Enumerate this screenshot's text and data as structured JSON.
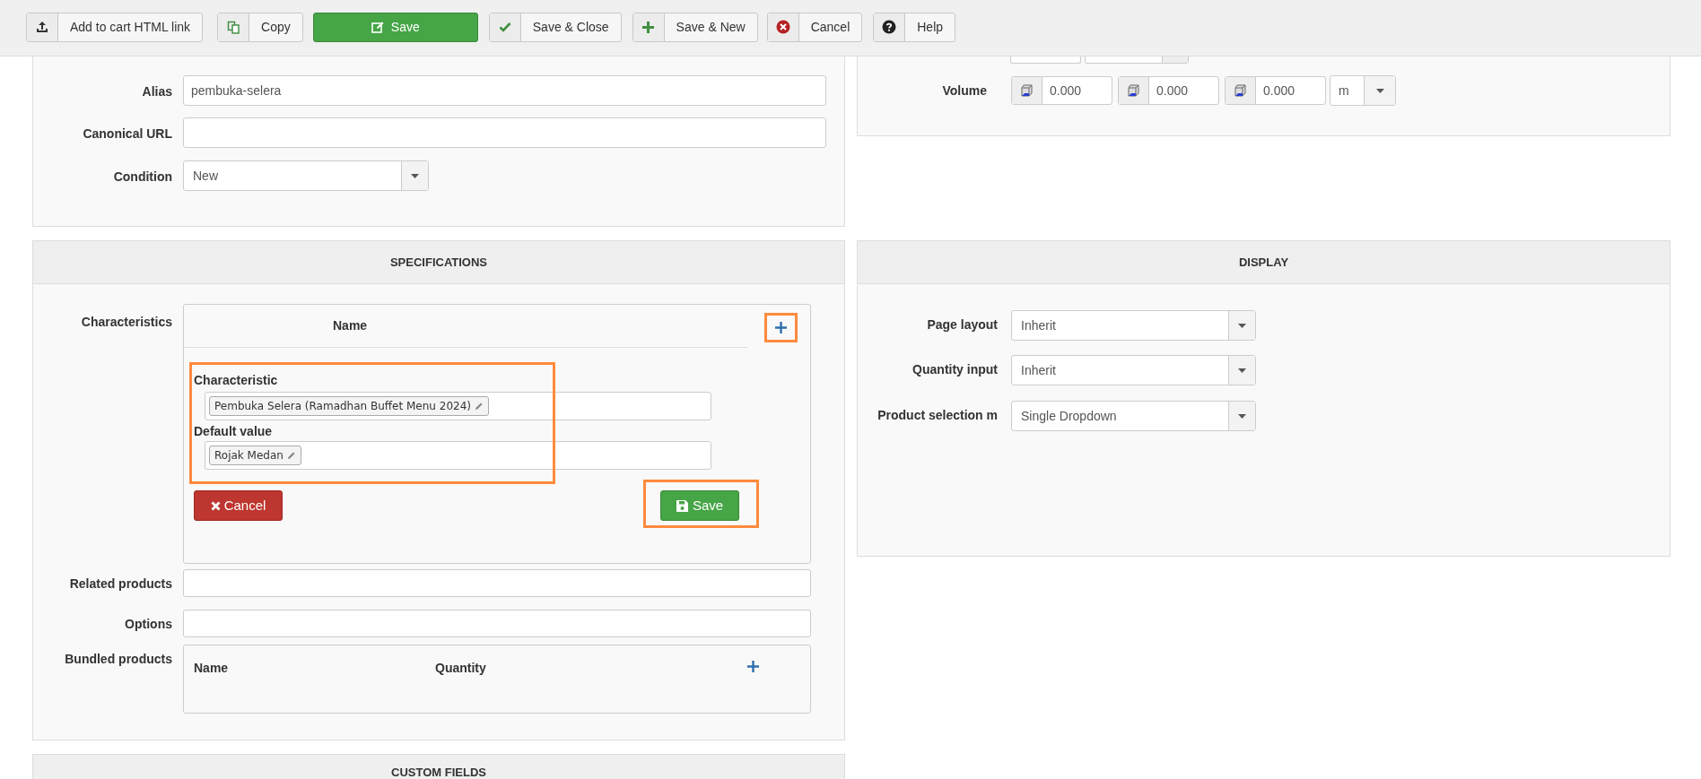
{
  "toolbar": {
    "buttons": [
      {
        "kind": "link",
        "label": "Add to cart HTML link"
      },
      {
        "kind": "copy",
        "label": "Copy"
      },
      {
        "kind": "save",
        "label": "Save"
      },
      {
        "kind": "save_close",
        "label": "Save & Close"
      },
      {
        "kind": "save_new",
        "label": "Save & New"
      },
      {
        "kind": "cancel",
        "label": "Cancel"
      },
      {
        "kind": "help",
        "label": "Help"
      }
    ]
  },
  "general": {
    "fields": [
      {
        "kind": "text",
        "label": "Alias",
        "value": "pembuka-selera"
      },
      {
        "kind": "text",
        "label": "Canonical URL"
      },
      {
        "kind": "select",
        "label": "Condition",
        "value": "New"
      }
    ]
  },
  "dimensions": {
    "volume": {
      "label": "Volume",
      "values": [
        "0.000",
        "0.000",
        "0.000"
      ],
      "unit": "m"
    }
  },
  "specifications": {
    "title": "SPECIFICATIONS",
    "characteristics": {
      "label": "Characteristics",
      "column": "Name",
      "add_highlighted": true,
      "editor": {
        "highlighted": true,
        "characteristic_label": "Characteristic",
        "characteristic_tag": "Pembuka Selera (Ramadhan Buffet Menu 2024)",
        "default_label": "Default value",
        "default_tag": "Rojak Medan",
        "cancel": "Cancel",
        "save": "Save",
        "save_highlighted": true
      }
    },
    "related_products": {
      "label": "Related products"
    },
    "options": {
      "label": "Options"
    },
    "bundled": {
      "label": "Bundled products",
      "columns": [
        "Name",
        "Quantity"
      ]
    }
  },
  "display": {
    "title": "DISPLAY",
    "fields": [
      {
        "label": "Page layout",
        "value": "Inherit"
      },
      {
        "label": "Quantity input",
        "value": "Inherit"
      },
      {
        "label": "Product selection m",
        "value": "Single Dropdown"
      }
    ]
  },
  "custom_fields": {
    "title": "CUSTOM FIELDS"
  }
}
